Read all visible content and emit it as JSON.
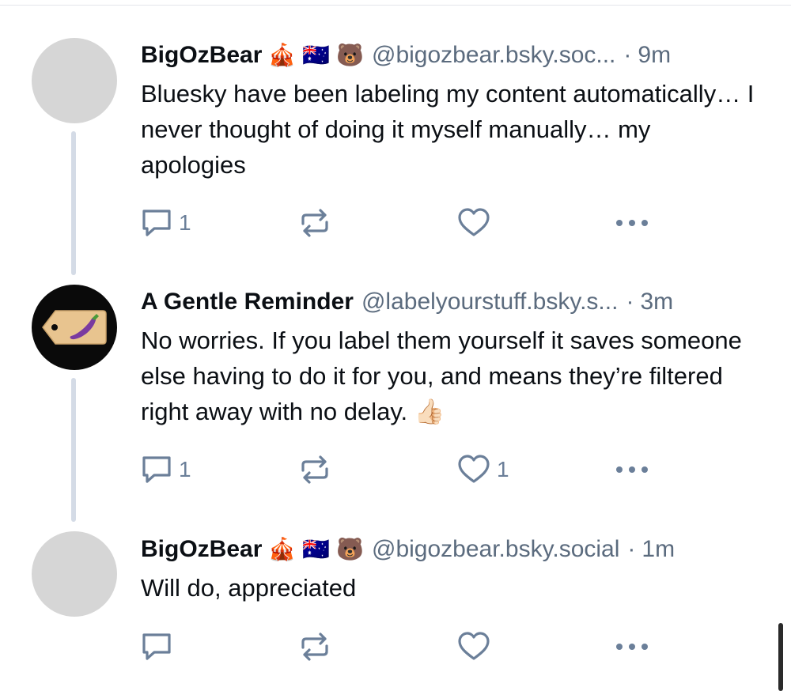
{
  "posts": [
    {
      "author_name": "BigOzBear",
      "emojis": [
        "🎪",
        "🇦🇺",
        "🐻"
      ],
      "handle": "@bigozbear.bsky.soc...",
      "separator": "·",
      "time": "9m",
      "text": "Bluesky have been labeling my content automatically… I never thought of doing it myself manually… my apologies",
      "reply_count": "1",
      "like_count": ""
    },
    {
      "author_name": "A Gentle Reminder",
      "emojis": [],
      "handle": "@labelyourstuff.bsky.s...",
      "separator": "·",
      "time": "3m",
      "text": "No worries. If you label them yourself it saves someone else having to do it for you, and means they’re filtered right away with no delay. 👍🏻",
      "reply_count": "1",
      "like_count": "1"
    },
    {
      "author_name": "BigOzBear",
      "emojis": [
        "🎪",
        "🇦🇺",
        "🐻"
      ],
      "handle": "@bigozbear.bsky.social",
      "separator": "·",
      "time": "1m",
      "text": "Will do, appreciated",
      "reply_count": "",
      "like_count": ""
    }
  ],
  "colors": {
    "text": "#0b0f14",
    "muted": "#5b6b7e",
    "icon": "#6b7f99",
    "thread_line": "#d4dbe6",
    "avatar_placeholder": "#d6d6d6"
  },
  "icons": {
    "reply": "reply-icon",
    "repost": "repost-icon",
    "like": "heart-icon",
    "more": "more-icon"
  }
}
